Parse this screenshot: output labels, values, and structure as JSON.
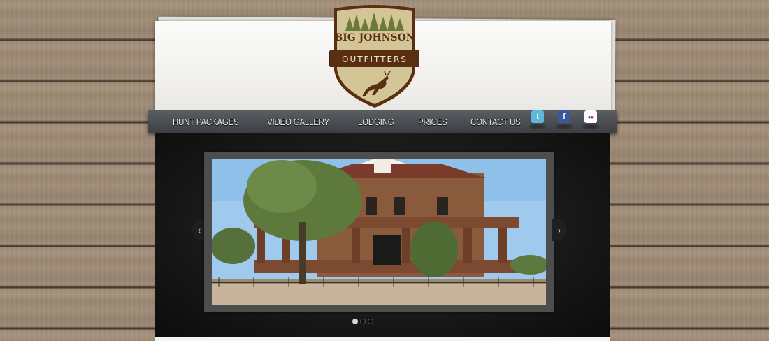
{
  "logo": {
    "line1": "BIG JOHNSON",
    "line2": "OUTFITTERS"
  },
  "nav": {
    "items": [
      {
        "label": "HUNT PACKAGES"
      },
      {
        "label": "VIDEO GALLERY"
      },
      {
        "label": "LODGING"
      },
      {
        "label": "PRICES"
      },
      {
        "label": "CONTACT US"
      }
    ]
  },
  "social": {
    "twitter": {
      "icon": "twitter-icon",
      "glyph": "t",
      "color": "#5eb7dd"
    },
    "facebook": {
      "icon": "facebook-icon",
      "glyph": "f",
      "color": "#3b5998"
    },
    "flickr": {
      "icon": "flickr-icon",
      "glyph": "••",
      "color": "#ffffff"
    }
  },
  "slider": {
    "prev_glyph": "‹",
    "next_glyph": "›",
    "slide_count": 3,
    "active_slide": 1
  },
  "colors": {
    "brand_brown": "#5a2e12",
    "brand_tan": "#cdbd8e",
    "nav_bg": "#45484c"
  }
}
